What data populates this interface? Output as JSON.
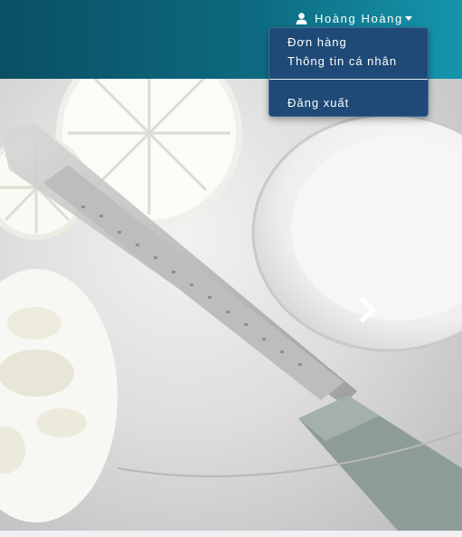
{
  "header": {
    "user": {
      "icon": "user-icon",
      "name": "Hoàng Hoàng",
      "caret_icon": "caret-down-icon"
    }
  },
  "dropdown": {
    "items": [
      {
        "label": "Đơn hàng"
      },
      {
        "label": "Thông tin cá nhân"
      }
    ],
    "logout_label": "Đăng xuất"
  },
  "carousel": {
    "next_icon": "chevron-right-icon"
  },
  "colors": {
    "header_start": "#0a4f63",
    "header_end": "#1596ad",
    "dropdown_bg": "#1f4a78"
  }
}
